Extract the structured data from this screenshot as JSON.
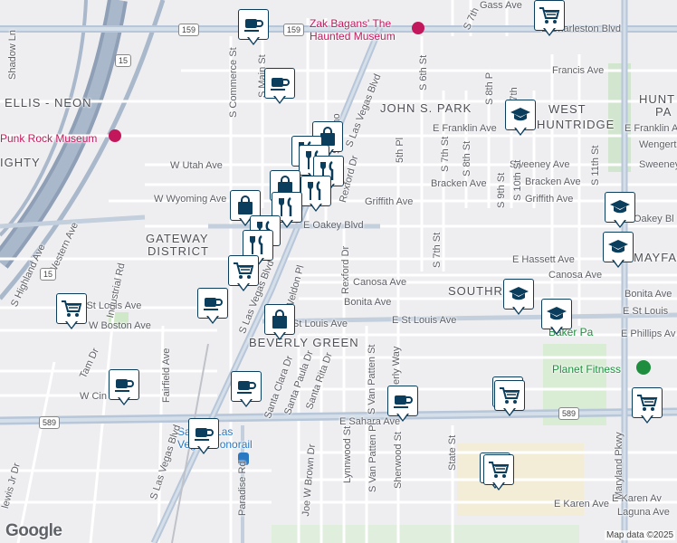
{
  "map": {
    "background": "#eeeef1",
    "road_color": "#ffffff",
    "major_road_color": "#b7c6d8",
    "highway_color": "#8e9fb6",
    "park_color": "#cfe8c8",
    "accent_marker": "#0b3d5c"
  },
  "labels": {
    "streets": {
      "e_charleston": "E Charleston Blvd",
      "francis": "Francis Ave",
      "e_franklin": "E Franklin Ave",
      "e_franklin_r": "E Franklin Av",
      "wengert": "Wengert",
      "sweeney": "Sweeney Ave",
      "sweeney_r": "Sweeney",
      "bracken": "Bracken Ave",
      "bracken_r": "Bracken Ave",
      "griffith": "Griffith Ave",
      "griffith_r": "Griffith Ave",
      "e_oakey": "E Oakey Blvd",
      "oakey_r": "Oakey Bl",
      "e_hassett": "E Hassett Ave",
      "canosa": "Canosa Ave",
      "canosa_r": "Canosa Ave",
      "bonita": "Bonita Ave",
      "bonita_r": "Bonita Ave",
      "e_st_louis": "E St Louis Ave",
      "e_st_louis_r": "E St Louis",
      "st_louis_w": "St Louis Ave",
      "w_st_louis": "W St Louis Ave",
      "e_phillips": "E Phillips Av",
      "w_utah": "W Utah Ave",
      "w_wyoming": "W Wyoming Ave",
      "w_boston": "W Boston Ave",
      "w_cin": "W Cin",
      "western": "Western Ave",
      "highland": "S Highland Ave",
      "industrial": "Industrial Rd",
      "fairfield": "Fairfield Ave",
      "tam": "Tam Dr",
      "e_sahara": "E Sahara Ave",
      "s_las_vegas": "S Las Vegas Blvd",
      "las_vegas_n": "S Las Vegas Blvd",
      "las_vegas_s": "S Las Vegas Blvd",
      "s_commerce": "S Commerce St",
      "s_casino": "S Casino",
      "s_main": "S Main St",
      "rexford": "Rexford Dr",
      "rexford2": "Rexford Dr",
      "fifth_pl": "5th Pl",
      "s_sixth": "S 6th St",
      "s_seventh": "S 7th St",
      "s_seventh2": "S 7th St",
      "s_seventh3": "S 7th St",
      "s_eighth": "S 8th St",
      "s_eighth_top": "S 8th P",
      "s_ninth": "S 9th St",
      "s_tenth": "S 10th St",
      "s_eleventh": "S 11th St",
      "maryland": "Maryland Pkwy",
      "state": "State St",
      "s_van_patten": "S Van Patten St",
      "s_van_patten_pl": "S Van Patten Pl",
      "lynnwood": "Lynnwood St",
      "sherwood": "Sherwood St",
      "waverly": "erly Way",
      "santa_clara": "Santa Clara Dr",
      "santa_paula": "Santa Paula Dr",
      "santa_rita": "Santa Rita Dr",
      "weldon": "Weldon Pl",
      "joe_brown": "Joe W Brown Dr",
      "paradise": "Paradise Rd",
      "lewis": "lewis Jr Dr",
      "shadow": "Shadow Ln",
      "e_karen": "E Karen Av",
      "e_karen2": "E Karen Ave",
      "laguna": "Laguna Ave",
      "s_seventh_top": "S 7th",
      "gass": "Gass Ave",
      "s_seventh_gass": "S 7th"
    },
    "areas": {
      "ellis": "ELLIS - NEON",
      "john_s_park": "JOHN S. PARK",
      "west": "WEST",
      "huntridge": "HUNTRIDGE",
      "hunt": "HUNT",
      "gateway": "GATEWAY",
      "district": "DISTRICT",
      "beverly": "BEVERLY GREEN",
      "southr": "SOUTHR",
      "mayfa": "MAYFA",
      "ighty": "IGHTY",
      "pa": "PA"
    },
    "pois": {
      "zak": "Zak Bagans' The",
      "zak2": "Haunted Museum",
      "punk": "Punk Rock Museum",
      "planet": "Planet Fitness",
      "baker": "Baker Pa",
      "sahara_mono": "Sahara Las",
      "sahara_mono2": "Vegas Monorail"
    },
    "shields": {
      "i15_a": "15",
      "i15_b": "15",
      "us159_a": "159",
      "us159_b": "159",
      "r589_a": "589",
      "r589_b": "589"
    }
  },
  "markers": [
    {
      "icon": "coffee"
    },
    {
      "icon": "cart"
    },
    {
      "icon": "cart"
    },
    {
      "icon": "coffee"
    },
    {
      "icon": "shopping-bag"
    },
    {
      "icon": "restaurant"
    },
    {
      "icon": "restaurant"
    },
    {
      "icon": "restaurant"
    },
    {
      "icon": "shopping-bag"
    },
    {
      "icon": "restaurant"
    },
    {
      "icon": "shopping-bag"
    },
    {
      "icon": "restaurant"
    },
    {
      "icon": "restaurant"
    },
    {
      "icon": "restaurant"
    },
    {
      "icon": "cart"
    },
    {
      "icon": "coffee"
    },
    {
      "icon": "shopping-bag"
    },
    {
      "icon": "cart"
    },
    {
      "icon": "coffee"
    },
    {
      "icon": "coffee"
    },
    {
      "icon": "coffee"
    },
    {
      "icon": "coffee"
    },
    {
      "icon": "school"
    },
    {
      "icon": "school"
    },
    {
      "icon": "school"
    },
    {
      "icon": "school"
    },
    {
      "icon": "school"
    },
    {
      "icon": "cart"
    },
    {
      "icon": "cart"
    },
    {
      "icon": "cart"
    },
    {
      "icon": "cart"
    }
  ],
  "footer": {
    "logo": "Google",
    "credit": "Map data ©2025"
  }
}
